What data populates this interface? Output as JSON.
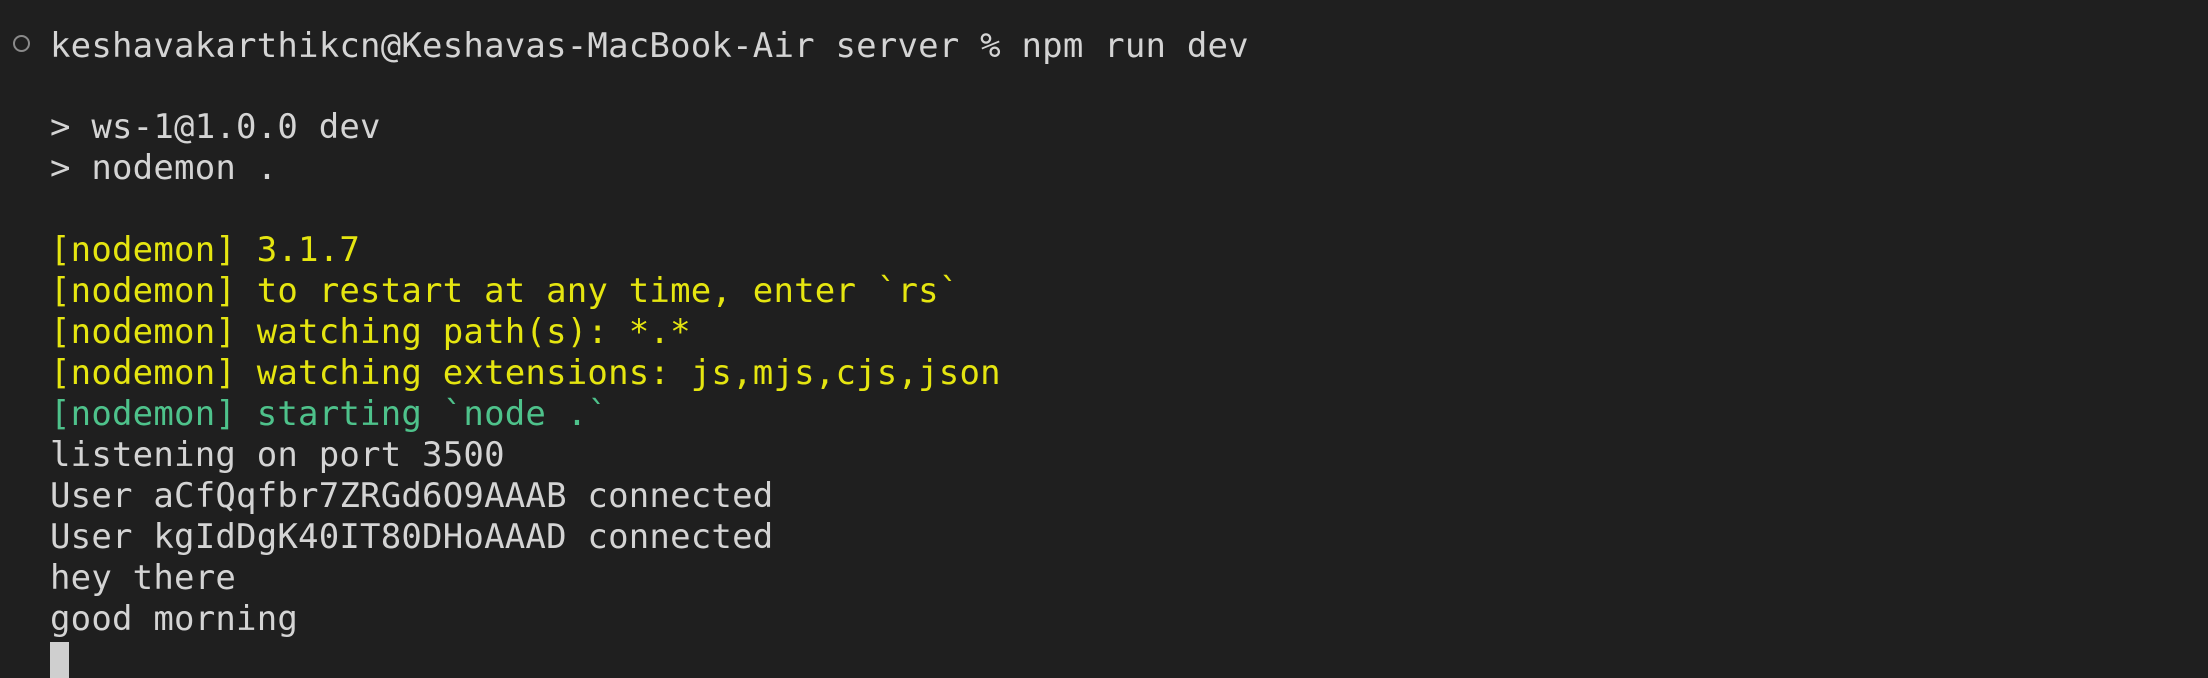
{
  "terminal": {
    "prompt_text": "keshavakarthikcn@Keshavas-MacBook-Air server % npm run dev",
    "lines": [
      "> ws-1@1.0.0 dev",
      "> nodemon .",
      "[nodemon] 3.1.7",
      "[nodemon] to restart at any time, enter `rs`",
      "[nodemon] watching path(s): *.*",
      "[nodemon] watching extensions: js,mjs,cjs,json",
      "[nodemon] starting `node .`",
      "listening on port 3500",
      "User aCfQqfbr7ZRGd6O9AAAB connected",
      "User kgIdDgK40IT80DHoAAAD connected",
      "hey there",
      "good morning"
    ],
    "colors": {
      "background": "#1f1f1f",
      "text": "#d4d4d4",
      "nodemon_yellow": "#e5e510",
      "nodemon_green": "#4ec28b"
    }
  }
}
